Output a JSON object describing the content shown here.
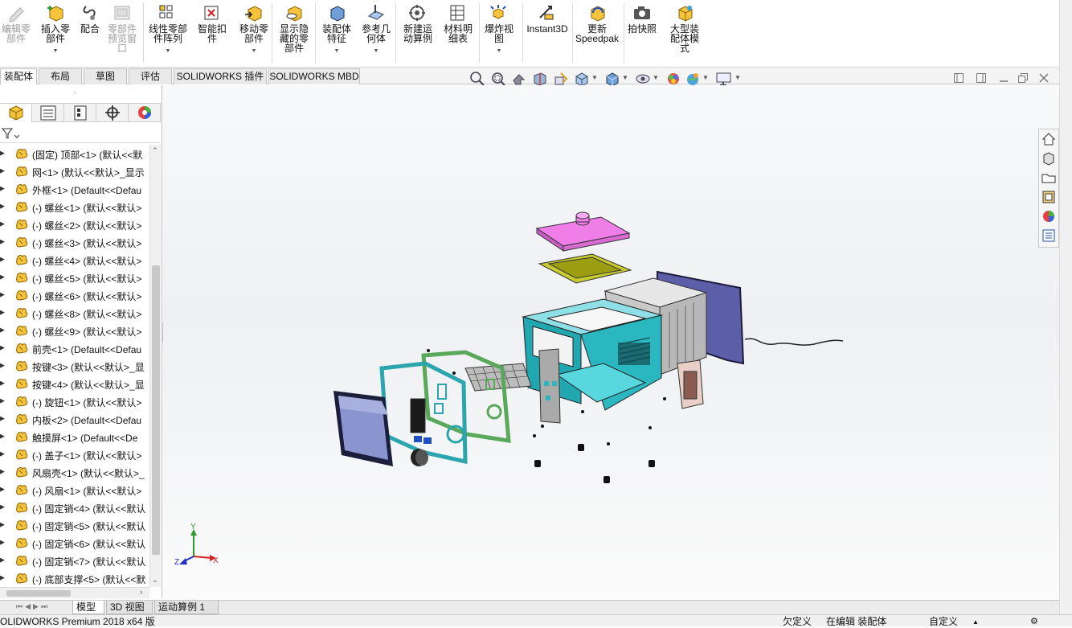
{
  "ribbon": {
    "buttons": [
      {
        "id": "edit-part",
        "label": "编辑零部件",
        "lines": [
          "编辑零",
          "部件"
        ],
        "disabled": true
      },
      {
        "id": "insert-parts",
        "label": "插入零部件",
        "lines": [
          "插入零",
          "部件"
        ],
        "disabled": false,
        "dropdown": true
      },
      {
        "id": "mate",
        "label": "配合",
        "lines": [
          "配合"
        ],
        "disabled": false
      },
      {
        "id": "component-preview",
        "label": "零部件预览窗口",
        "lines": [
          "零部件",
          "预览窗",
          "口"
        ],
        "disabled": true
      },
      {
        "id": "linear-pattern",
        "label": "线性零部件阵列",
        "lines": [
          "线性零部",
          "件阵列"
        ],
        "disabled": false,
        "dropdown": true
      },
      {
        "id": "smart-fasteners",
        "label": "智能扣件",
        "lines": [
          "智能扣",
          "件"
        ],
        "disabled": false
      },
      {
        "id": "move-component",
        "label": "移动零部件",
        "lines": [
          "移动零",
          "部件"
        ],
        "disabled": false,
        "dropdown": true
      },
      {
        "id": "show-hidden",
        "label": "显示隐藏的零部件",
        "lines": [
          "显示隐",
          "藏的零",
          "部件"
        ],
        "disabled": false
      },
      {
        "id": "assembly-features",
        "label": "装配体特征",
        "lines": [
          "装配体",
          "特征"
        ],
        "disabled": false,
        "dropdown": true
      },
      {
        "id": "reference-geometry",
        "label": "参考几何体",
        "lines": [
          "参考几",
          "何体"
        ],
        "disabled": false,
        "dropdown": true
      },
      {
        "id": "new-motion-study",
        "label": "新建运动算例",
        "lines": [
          "新建运",
          "动算例"
        ],
        "disabled": false
      },
      {
        "id": "bom",
        "label": "材料明细表",
        "lines": [
          "材料明",
          "细表"
        ],
        "disabled": false
      },
      {
        "id": "exploded-view",
        "label": "爆炸视图",
        "lines": [
          "爆炸视",
          "图"
        ],
        "disabled": false,
        "dropdown": true
      },
      {
        "id": "instant3d",
        "label": "Instant3D",
        "lines": [
          "Instant3D"
        ],
        "disabled": false
      },
      {
        "id": "update-speedpak",
        "label": "更新Speedpak",
        "lines": [
          "更新",
          "Speedpak"
        ],
        "disabled": false
      },
      {
        "id": "snapshot",
        "label": "拍快照",
        "lines": [
          "拍快照"
        ],
        "disabled": false
      },
      {
        "id": "large-assembly",
        "label": "大型装配体模式",
        "lines": [
          "大型装",
          "配体模",
          "式"
        ],
        "disabled": false
      }
    ]
  },
  "tabs": [
    "装配体",
    "布局",
    "草图",
    "评估",
    "SOLIDWORKS 插件",
    "SOLIDWORKS MBD"
  ],
  "active_tab": 0,
  "tree": [
    "(固定) 顶部<1> (默认<<默",
    "网<1> (默认<<默认>_显示",
    "外框<1> (Default<<Defau",
    "(-) 螺丝<1> (默认<<默认>",
    "(-) 螺丝<2> (默认<<默认>",
    "(-) 螺丝<3> (默认<<默认>",
    "(-) 螺丝<4> (默认<<默认>",
    "(-) 螺丝<5> (默认<<默认>",
    "(-) 螺丝<6> (默认<<默认>",
    "(-) 螺丝<8> (默认<<默认>",
    "(-) 螺丝<9> (默认<<默认>",
    "前壳<1> (Default<<Defau",
    "按键<3> (默认<<默认>_显",
    "按键<4> (默认<<默认>_显",
    "(-) 旋钮<1> (默认<<默认>",
    "内板<2> (Default<<Defau",
    "触摸屏<1> (Default<<De",
    "(-) 盖子<1> (默认<<默认>",
    "风扇壳<1> (默认<<默认>_",
    "(-) 风扇<1> (默认<<默认>",
    "(-) 固定销<4> (默认<<默认",
    "(-) 固定销<5> (默认<<默认",
    "(-) 固定销<6> (默认<<默认",
    "(-) 固定销<7> (默认<<默认",
    "(-) 底部支撑<5> (默认<<默"
  ],
  "bottom_tabs": [
    "模型",
    "3D 视图",
    "运动算例 1"
  ],
  "active_bottom_tab": 0,
  "status": {
    "app": "OLIDWORKS Premium 2018 x64 版",
    "definition": "欠定义",
    "mode": "在编辑 装配体",
    "custom": "自定义"
  },
  "triad": {
    "x": "X",
    "y": "Y",
    "z": "Z"
  },
  "colors": {
    "cyan_shell": "#2bb7c0",
    "lid": "#ef7ee8",
    "tray": "#c8cc30",
    "green_frame": "#5aa85a",
    "purple_panel": "#5c5ea8",
    "accent_icon": "#f0a020"
  }
}
